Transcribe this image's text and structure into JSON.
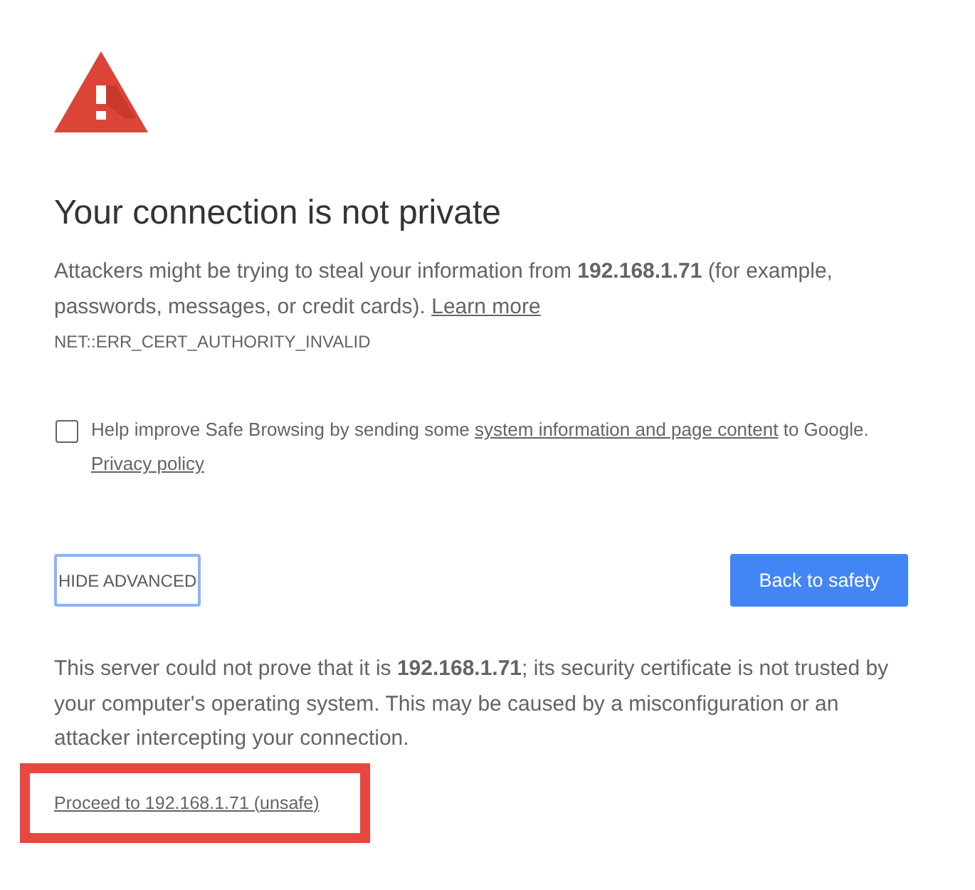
{
  "title": "Your connection is not private",
  "intro": {
    "text": "Attackers might be trying to steal your information from **192.168.1.71** (for example, passwords, messages, or credit cards).",
    "link": "Learn more"
  },
  "error_code": "NET::ERR_CERT_AUTHORITY_INVALID",
  "safe_browsing": {
    "checked": false,
    "text_before": "Help improve Safe Browsing by sending some",
    "link": "system information and page content",
    "text_after": "to Google.",
    "policy_link": "Privacy policy"
  },
  "buttons": [
    {
      "label": "HIDE ADVANCED",
      "kind": "secondary",
      "focused": true
    },
    {
      "label": "Back to safety",
      "kind": "primary",
      "focused": false
    }
  ],
  "details": "This server could not prove that it is **192.168.1.71**; its security certificate is not trusted by your computer's operating system. This may be caused by a misconfiguration or an attacker intercepting your connection.",
  "proceed_link": {
    "text": "Proceed to 192.168.1.71 (unsafe)",
    "highlighted": true
  }
}
